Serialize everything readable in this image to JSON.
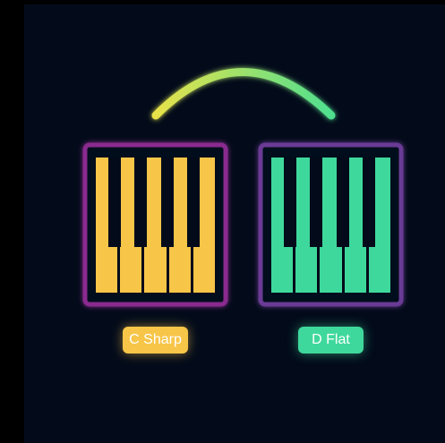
{
  "colors": {
    "page_background": "#000000",
    "panel_background": "#030b1a",
    "left_accent": "#f7c548",
    "right_accent": "#3fd89c",
    "left_frame": "#8a2b8f",
    "right_frame": "#6a3a95",
    "arc_start": "#e8e24a",
    "arc_end": "#4fe08f"
  },
  "arc": {
    "icon": "connection-arc-icon"
  },
  "keyboards": [
    {
      "icon": "piano-keys-icon",
      "accent": "#f7c548"
    },
    {
      "icon": "piano-keys-icon",
      "accent": "#3fd89c"
    }
  ],
  "labels": {
    "left": "C Sharp",
    "right": "D Flat"
  }
}
